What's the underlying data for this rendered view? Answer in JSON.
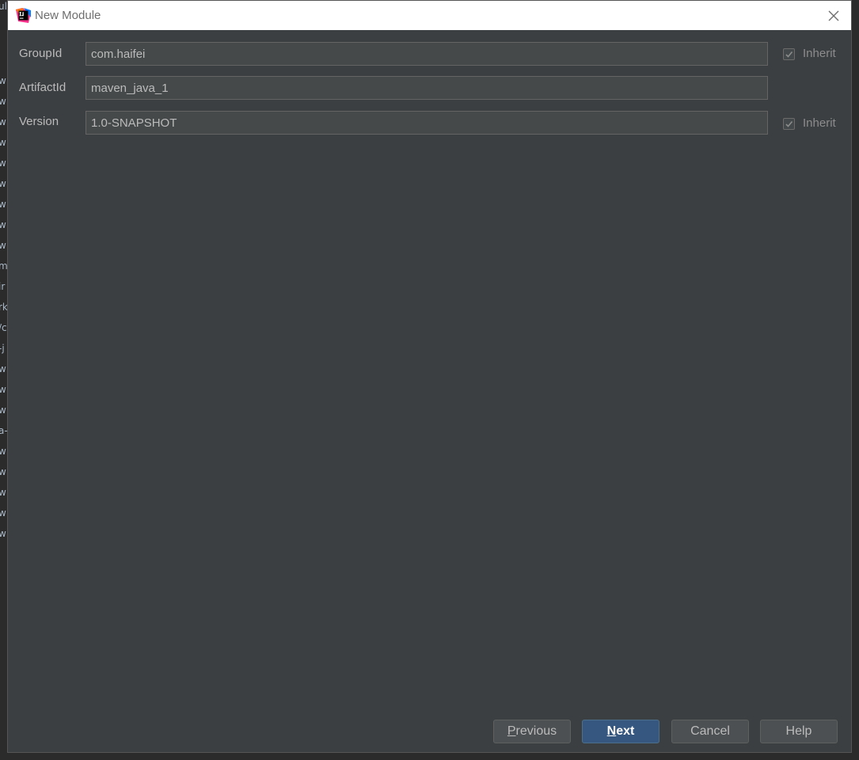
{
  "background": {
    "left_fragments": [
      "ul",
      "w",
      "w",
      "w",
      "w",
      "w",
      "w",
      "w",
      "w",
      "w",
      "m",
      "ir",
      "rk",
      "/c",
      "-j",
      "w",
      "w",
      "w",
      "a-",
      "w",
      "w",
      "w",
      "w",
      "w"
    ]
  },
  "dialog": {
    "title": "New Module",
    "close_icon": "close-icon",
    "app_icon": "intellij-idea-icon"
  },
  "form": {
    "group_id": {
      "label": "GroupId",
      "value": "com.haifei",
      "inherit": {
        "label": "Inherit",
        "checked": true
      }
    },
    "artifact_id": {
      "label": "ArtifactId",
      "value": "maven_java_1"
    },
    "version": {
      "label": "Version",
      "value": "1.0-SNAPSHOT",
      "inherit": {
        "label": "Inherit",
        "checked": true
      }
    }
  },
  "buttons": {
    "previous": {
      "mnemonic": "P",
      "rest": "revious"
    },
    "next": {
      "mnemonic": "N",
      "rest": "ext"
    },
    "cancel": "Cancel",
    "help": "Help"
  },
  "colors": {
    "dialog_bg": "#3c3f41",
    "field_bg": "#45494a",
    "primary_button": "#365880",
    "title_bar": "#ffffff"
  }
}
